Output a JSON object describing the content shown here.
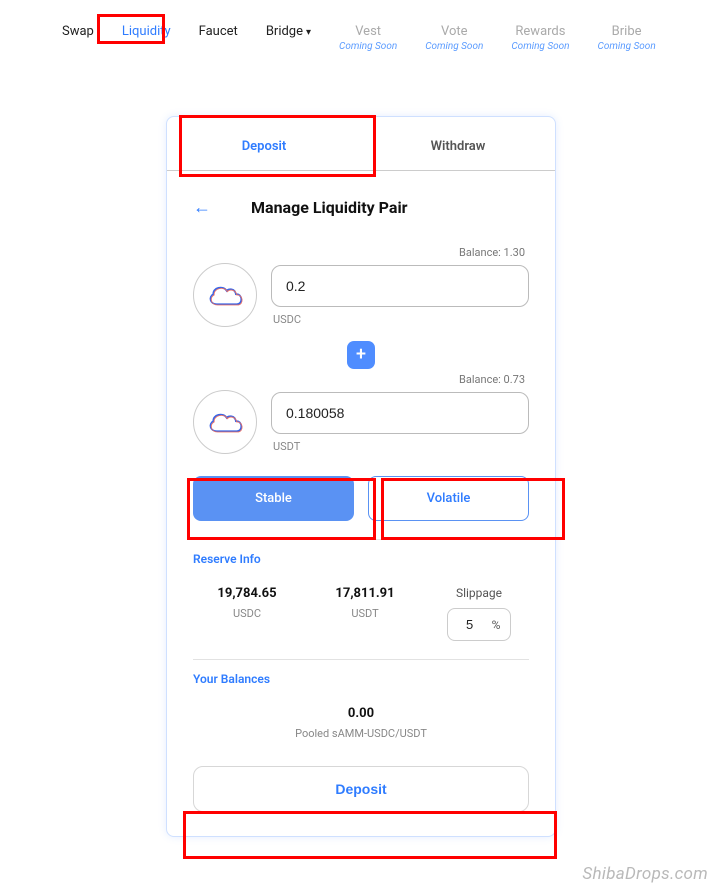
{
  "nav": {
    "swap": "Swap",
    "liquidity": "Liquidity",
    "faucet": "Faucet",
    "bridge": "Bridge",
    "vest": "Vest",
    "vote": "Vote",
    "rewards": "Rewards",
    "bribe": "Bribe",
    "coming": "Coming Soon"
  },
  "tabs": {
    "deposit": "Deposit",
    "withdraw": "Withdraw"
  },
  "title": "Manage Liquidity Pair",
  "token0": {
    "balance_label": "Balance: 1.30",
    "value": "0.2",
    "symbol": "USDC"
  },
  "token1": {
    "balance_label": "Balance: 0.73",
    "value": "0.180058",
    "symbol": "USDT"
  },
  "plus": "+",
  "pool": {
    "stable": "Stable",
    "volatile": "Volatile"
  },
  "reserve": {
    "title": "Reserve Info",
    "a_value": "19,784.65",
    "a_label": "USDC",
    "b_value": "17,811.91",
    "b_label": "USDT",
    "slippage_title": "Slippage",
    "slippage_value": "5",
    "slippage_pct": "%"
  },
  "balances": {
    "title": "Your Balances",
    "value": "0.00",
    "label": "Pooled sAMM-USDC/USDT"
  },
  "action": "Deposit",
  "watermark": "ShibaDrops.com"
}
